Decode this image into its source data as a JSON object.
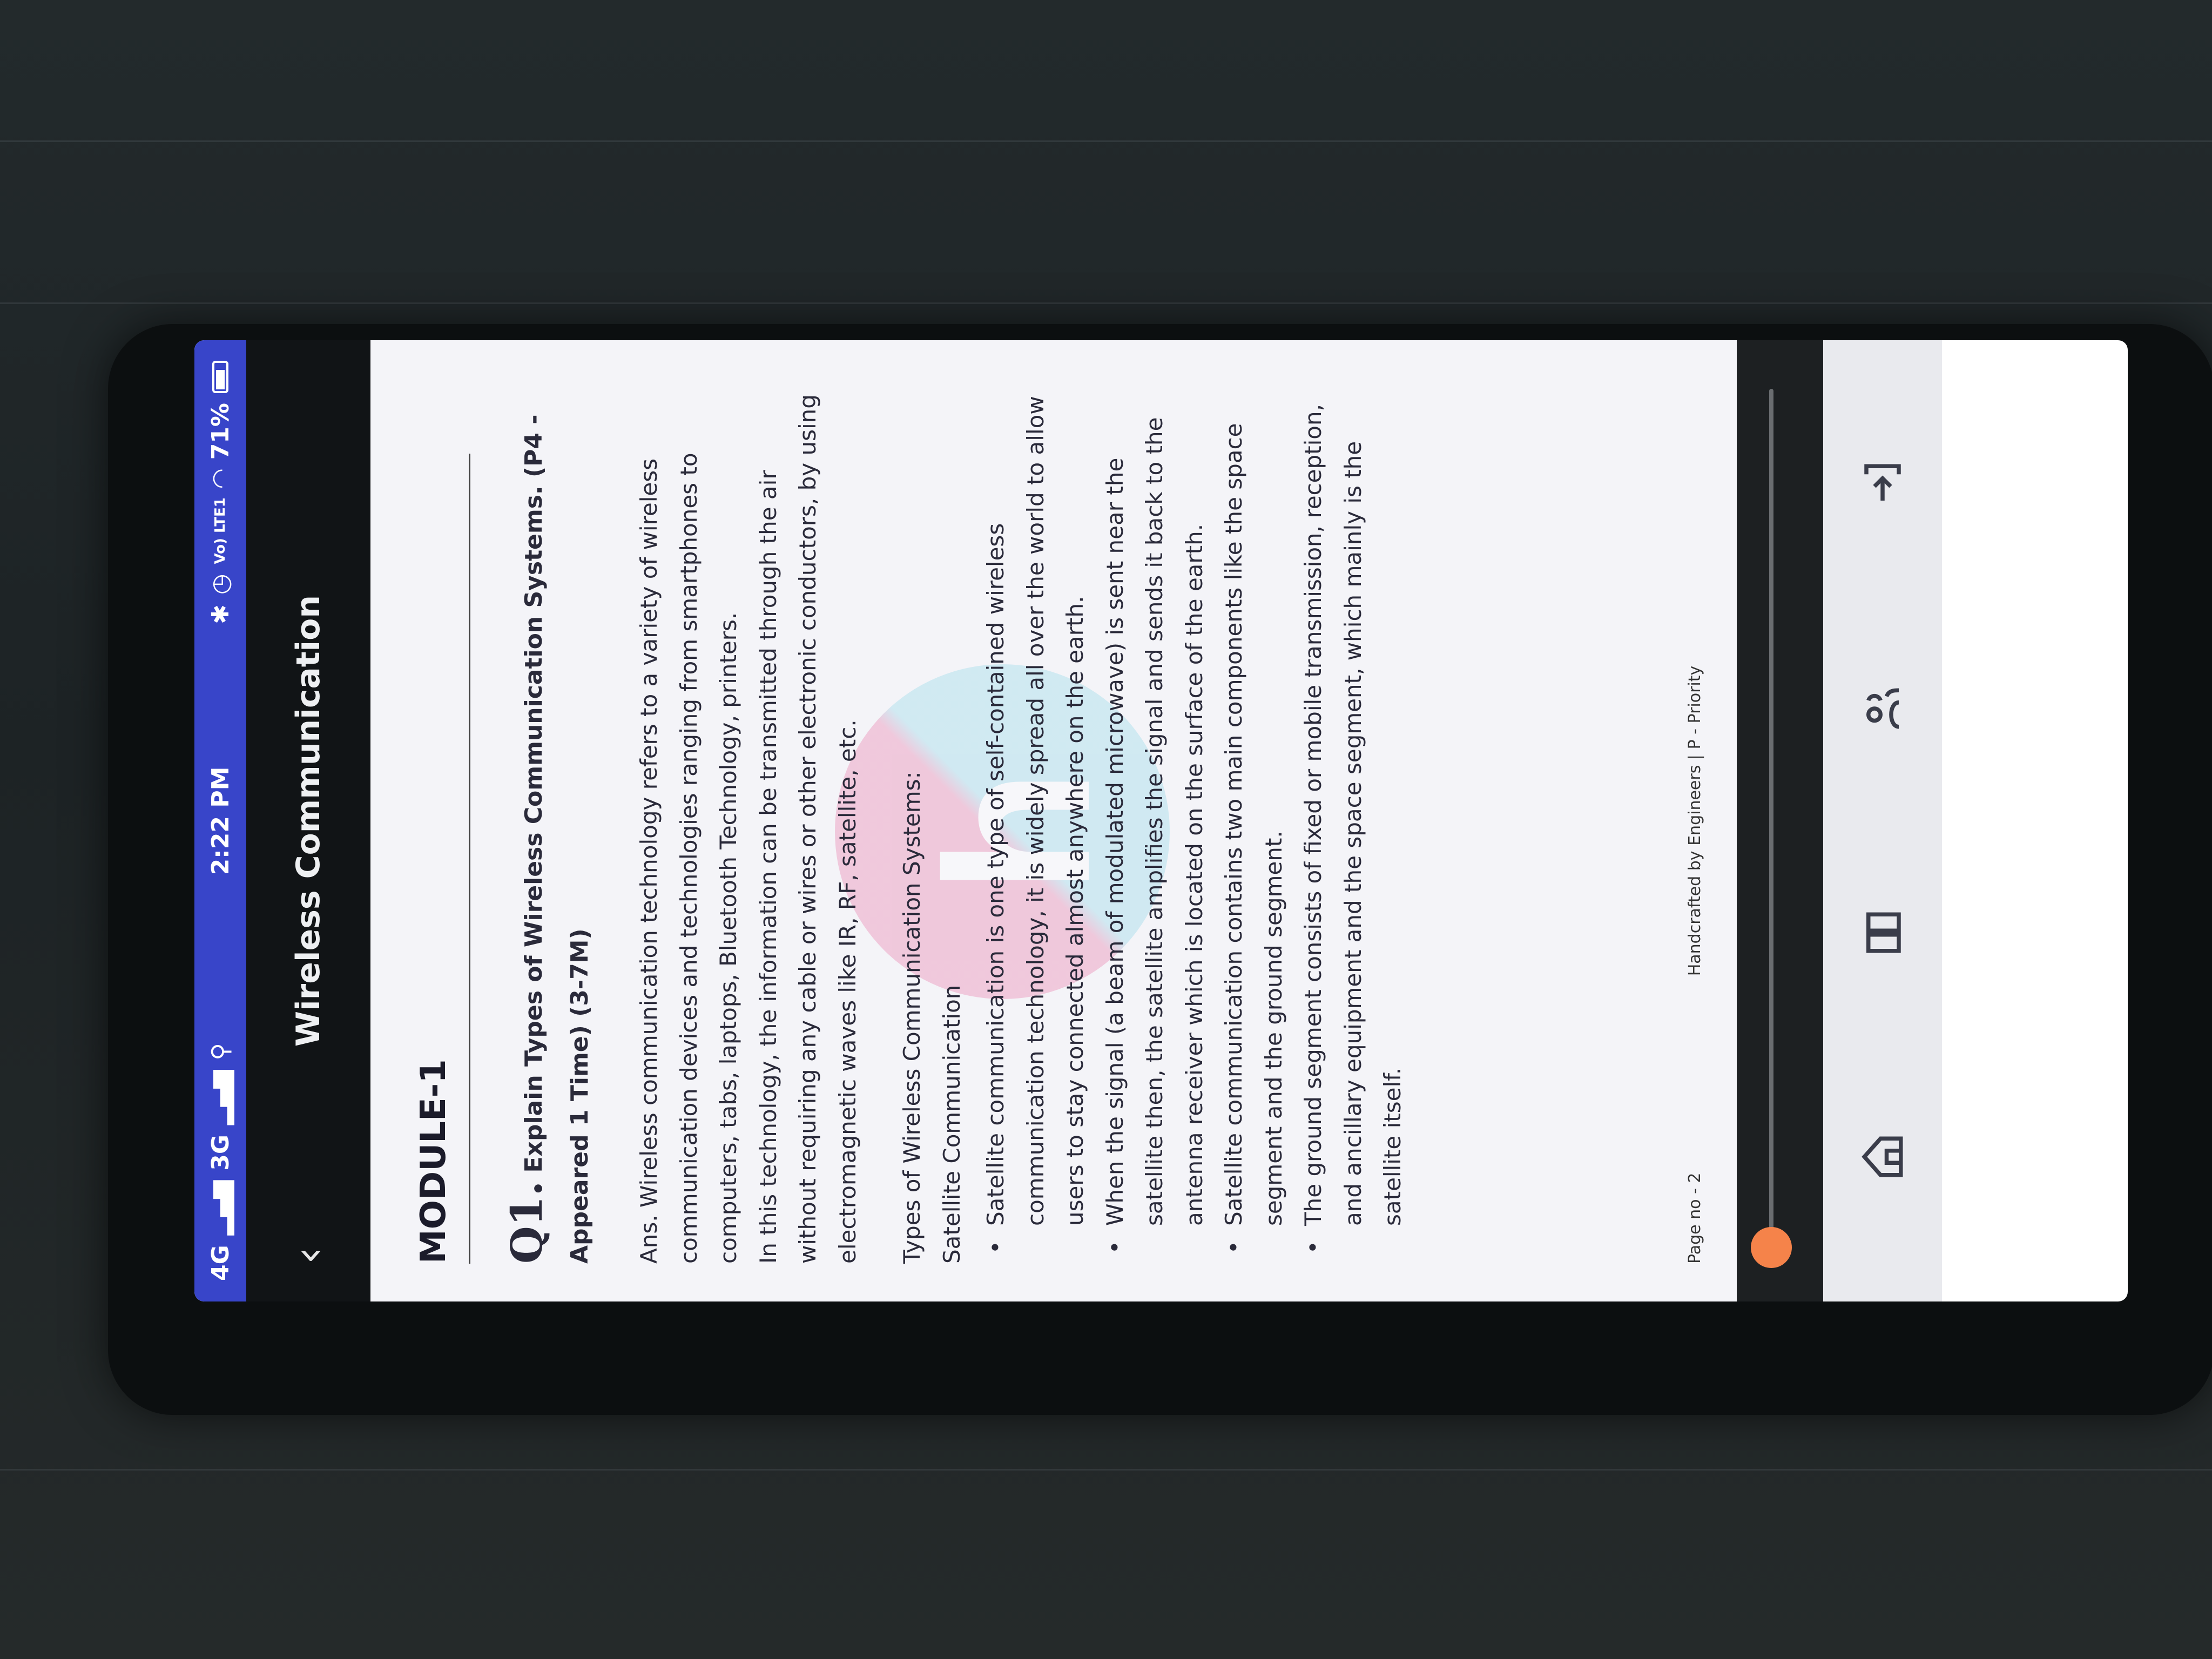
{
  "status_bar": {
    "network": "4G",
    "network2": "3G",
    "time": "2:22 PM",
    "lte_label": "Vo) LTE1",
    "battery": "71%"
  },
  "header": {
    "title": "Wireless Communication"
  },
  "document": {
    "module": "MODULE-1",
    "question_number": "Q1.",
    "question_text": "Explain Types of Wireless Communication Systems. (P4 - Appeared 1 Time) (3-7M)",
    "answer_lines": [
      "Ans. Wireless communication technology refers to a variety of wireless communication devices and technologies ranging from smartphones to computers, tabs, laptops, Bluetooth Technology, printers.",
      "In this technology, the information can be transmitted through the air without requiring any cable or wires or other electronic conductors, by using electromagnetic waves like IR, RF, satellite, etc."
    ],
    "types_heading": "Types of Wireless Communication Systems:",
    "subheading": "Satellite Communication",
    "bullets": [
      "Satellite communication is one type of self-contained wireless communication technology, it is widely spread all over the world to allow users to stay connected almost anywhere on the earth.",
      "When the signal (a beam of modulated microwave) is sent near the satellite then, the satellite amplifies the signal and sends it back to the antenna receiver which is located on the surface of the earth.",
      "Satellite communication contains two main components like the space segment and the ground segment.",
      "The ground segment consists of fixed or mobile transmission, reception, and ancillary equipment and the space segment, which mainly is the satellite itself."
    ],
    "page_no": "Page no - 2",
    "credit": "Handcrafted by Engineers | P - Priority",
    "watermark_letter": "h"
  },
  "icons": {
    "back": "chevron-left-icon",
    "home": "home-icon",
    "book": "book-icon",
    "share": "people-icon",
    "download": "download-icon"
  },
  "colors": {
    "status_bar": "#3845c9",
    "header": "#111416",
    "thumb": "#f5834a"
  }
}
